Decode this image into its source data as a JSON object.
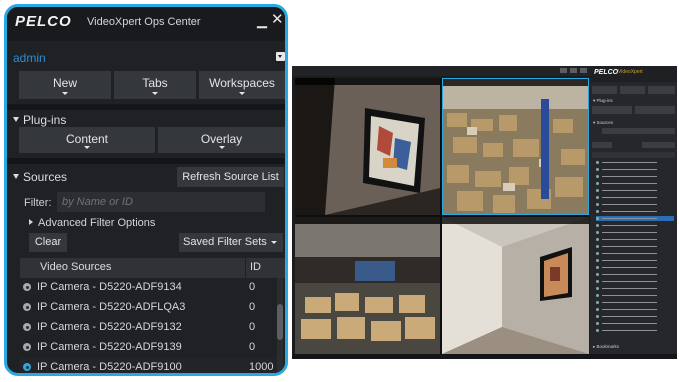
{
  "app": {
    "logo": "PELCO",
    "title": "VideoXpert Ops Center",
    "minimize_glyph": "▁",
    "close_glyph": "✕"
  },
  "user": {
    "name": "admin"
  },
  "toolbar": {
    "new_label": "New",
    "tabs_label": "Tabs",
    "workspaces_label": "Workspaces"
  },
  "plugins": {
    "heading": "Plug-ins",
    "content_label": "Content",
    "overlay_label": "Overlay"
  },
  "sources": {
    "heading": "Sources",
    "refresh_label": "Refresh Source List",
    "filter_label": "Filter:",
    "filter_placeholder": "by Name or ID",
    "advanced_label": "Advanced Filter Options",
    "clear_label": "Clear",
    "saved_filters_label": "Saved Filter Sets",
    "columns": {
      "name": "Video Sources",
      "id": "ID"
    },
    "rows": [
      {
        "name": "IP Camera - D5220-ADF9134",
        "id": "0"
      },
      {
        "name": "IP Camera - D5220-ADFLQA3",
        "id": "0"
      },
      {
        "name": "IP Camera - D5220-ADF9132",
        "id": "0"
      },
      {
        "name": "IP Camera - D5220-ADF9139",
        "id": "0"
      },
      {
        "name": "IP Camera - D5220-ADF9100",
        "id": "1000"
      }
    ]
  },
  "colors": {
    "accent": "#29a9e1",
    "panel_bg": "#1f2125",
    "user": "#2b8ed4",
    "live_time": "#27c24c"
  }
}
